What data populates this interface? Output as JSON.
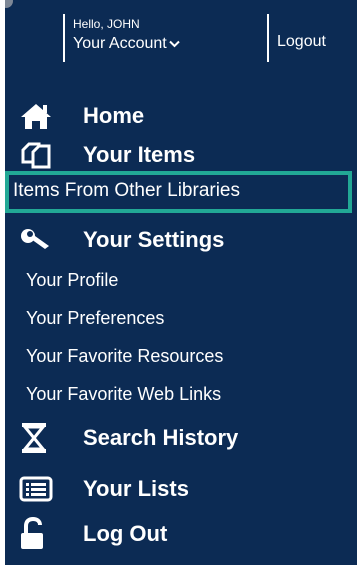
{
  "account": {
    "greeting": "Hello, JOHN",
    "account_label": "Your Account",
    "logout_label": "Logout"
  },
  "menu": {
    "home": {
      "label": "Home",
      "icon": "home-icon"
    },
    "your_items": {
      "label": "Your Items",
      "icon": "copy-items-icon"
    },
    "items_from_other_libraries": {
      "label": "Items From Other Libraries"
    },
    "your_settings": {
      "label": "Your Settings",
      "icon": "wrench-icon"
    },
    "your_profile": {
      "label": "Your Profile"
    },
    "your_preferences": {
      "label": "Your Preferences"
    },
    "your_favorite_resources": {
      "label": "Your Favorite Resources"
    },
    "your_favorite_web_links": {
      "label": "Your Favorite Web Links"
    },
    "search_history": {
      "label": "Search History",
      "icon": "hourglass-icon"
    },
    "your_lists": {
      "label": "Your Lists",
      "icon": "list-icon"
    },
    "log_out": {
      "label": "Log Out",
      "icon": "unlock-icon"
    }
  },
  "colors": {
    "panel_bg": "#0c2b54",
    "highlight": "#22a895",
    "text": "#ffffff"
  }
}
